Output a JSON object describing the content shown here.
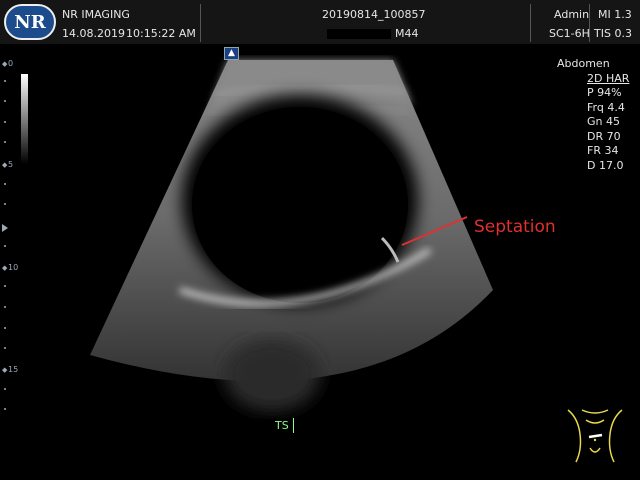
{
  "header": {
    "brand": "NR IMAGING",
    "logo_text": "NR",
    "date": "14.08.2019",
    "time": "10:15:22 AM",
    "study_id": "20190814_100857",
    "patient_suffix": "M44",
    "user": "Admin",
    "probe": "SC1-6H",
    "mi": "MI 1.3",
    "tis": "TIS 0.3"
  },
  "probe_indicator": "▲",
  "depth_scale": {
    "labels": [
      "0",
      "5",
      "10",
      "15"
    ]
  },
  "params": {
    "preset": "Abdomen",
    "mode": "2D HAR",
    "items": [
      "P 94%",
      "Frq 4.4",
      "Gn 45",
      "DR 70",
      "FR 34",
      "D 17.0"
    ]
  },
  "annotation": {
    "label": "Septation",
    "color": "#e03030"
  },
  "orientation_label": "TS",
  "body_marker": "abdomen-icon"
}
